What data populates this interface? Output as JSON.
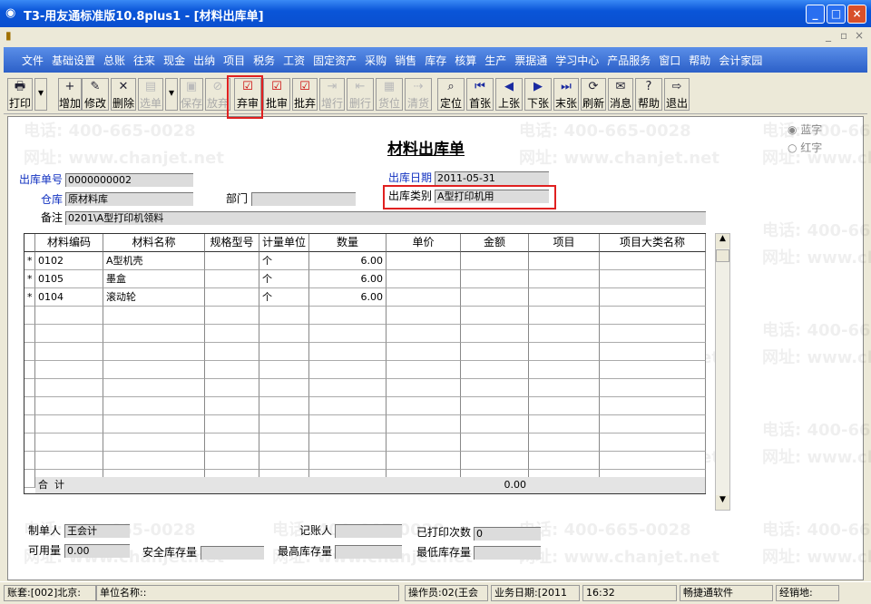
{
  "window": {
    "title": "T3-用友通标准版10.8plus1 - [材料出库单]",
    "min": "_",
    "max": "□",
    "close": "×",
    "child_min": "_",
    "child_restore": "▫",
    "child_close": "×"
  },
  "menu": [
    "文件",
    "基础设置",
    "总账",
    "往来",
    "现金",
    "出纳",
    "项目",
    "税务",
    "工资",
    "固定资产",
    "采购",
    "销售",
    "库存",
    "核算",
    "生产",
    "票据通",
    "学习中心",
    "产品服务",
    "窗口",
    "帮助",
    "会计家园"
  ],
  "toolbar": [
    {
      "label": "打印",
      "icon": "printer-icon",
      "glyph": "🖶",
      "enabled": true
    },
    {
      "label": "增加",
      "icon": "add-icon",
      "glyph": "+",
      "enabled": true
    },
    {
      "label": "修改",
      "icon": "edit-icon",
      "glyph": "✎",
      "enabled": true
    },
    {
      "label": "删除",
      "icon": "delete-icon",
      "glyph": "✕",
      "enabled": true
    },
    {
      "label": "选单",
      "icon": "select-icon",
      "glyph": "▤",
      "enabled": false
    },
    {
      "label": "保存",
      "icon": "save-icon",
      "glyph": "▣",
      "enabled": false
    },
    {
      "label": "放弃",
      "icon": "discard-icon",
      "glyph": "⊘",
      "enabled": false
    },
    {
      "label": "弃审",
      "icon": "unapprove-icon",
      "glyph": "☑",
      "enabled": true
    },
    {
      "label": "批审",
      "icon": "batch-approve-icon",
      "glyph": "☑",
      "enabled": true
    },
    {
      "label": "批弃",
      "icon": "batch-unapprove-icon",
      "glyph": "☑",
      "enabled": true
    },
    {
      "label": "增行",
      "icon": "add-row-icon",
      "glyph": "⇥",
      "enabled": false
    },
    {
      "label": "删行",
      "icon": "delete-row-icon",
      "glyph": "⇤",
      "enabled": false
    },
    {
      "label": "货位",
      "icon": "location-icon",
      "glyph": "▦",
      "enabled": false
    },
    {
      "label": "清货",
      "icon": "clear-icon",
      "glyph": "⇢",
      "enabled": false
    },
    {
      "label": "定位",
      "icon": "locate-icon",
      "glyph": "⌕",
      "enabled": true
    },
    {
      "label": "首张",
      "icon": "first-icon",
      "glyph": "⏮",
      "enabled": true
    },
    {
      "label": "上张",
      "icon": "prev-icon",
      "glyph": "◀",
      "enabled": true
    },
    {
      "label": "下张",
      "icon": "next-icon",
      "glyph": "▶",
      "enabled": true
    },
    {
      "label": "末张",
      "icon": "last-icon",
      "glyph": "⏭",
      "enabled": true
    },
    {
      "label": "刷新",
      "icon": "refresh-icon",
      "glyph": "⟳",
      "enabled": true
    },
    {
      "label": "消息",
      "icon": "message-icon",
      "glyph": "✉",
      "enabled": true
    },
    {
      "label": "帮助",
      "icon": "help-icon",
      "glyph": "?",
      "enabled": true
    },
    {
      "label": "退出",
      "icon": "exit-icon",
      "glyph": "⇨",
      "enabled": true
    }
  ],
  "form": {
    "title": "材料出库单",
    "color_options": {
      "blue": "蓝字",
      "red": "红字",
      "selected": "blue"
    },
    "doc_no_label": "出库单号",
    "doc_no": "0000000002",
    "date_label": "出库日期",
    "date": "2011-05-31",
    "warehouse_label": "仓库",
    "warehouse": "原材料库",
    "dept_label": "部门",
    "dept": "",
    "type_label": "出库类别",
    "type": "A型打印机用",
    "memo_label": "备注",
    "memo": "0201\\A型打印机领料"
  },
  "grid": {
    "columns": [
      "材料编码",
      "材料名称",
      "规格型号",
      "计量单位",
      "数量",
      "单价",
      "金额",
      "项目",
      "项目大类名称"
    ],
    "rows": [
      [
        "0102",
        "A型机壳",
        "",
        "个",
        "6.00",
        "",
        "",
        "",
        ""
      ],
      [
        "0105",
        "墨盒",
        "",
        "个",
        "6.00",
        "",
        "",
        "",
        ""
      ],
      [
        "0104",
        "滚动轮",
        "",
        "个",
        "6.00",
        "",
        "",
        "",
        ""
      ]
    ],
    "row_marker": "*",
    "total_label": "合  计",
    "total_amount": "0.00"
  },
  "footer": {
    "maker_label": "制单人",
    "maker": "王会计",
    "bookkeeper_label": "记账人",
    "bookkeeper": "",
    "printed_label": "已打印次数",
    "printed": "0",
    "available_label": "可用量",
    "available": "0.00",
    "safety_label": "安全库存量",
    "safety": "",
    "max_label": "最高库存量",
    "max": "",
    "min_label": "最低库存量",
    "min": ""
  },
  "status": [
    "账套:[002]北京:",
    "单位名称::",
    "操作员:02(王会",
    "业务日期:[2011",
    "16:32",
    "畅捷通软件",
    "经销地:"
  ],
  "watermark": {
    "phone": "电话: 400-665-0028",
    "site": "网址: www.chanjet.net"
  },
  "colors": {
    "title_bar": "#0a55d8",
    "menu_bar": "#2c60c8",
    "highlight": "#e02020",
    "label_blue": "#1030c0"
  }
}
